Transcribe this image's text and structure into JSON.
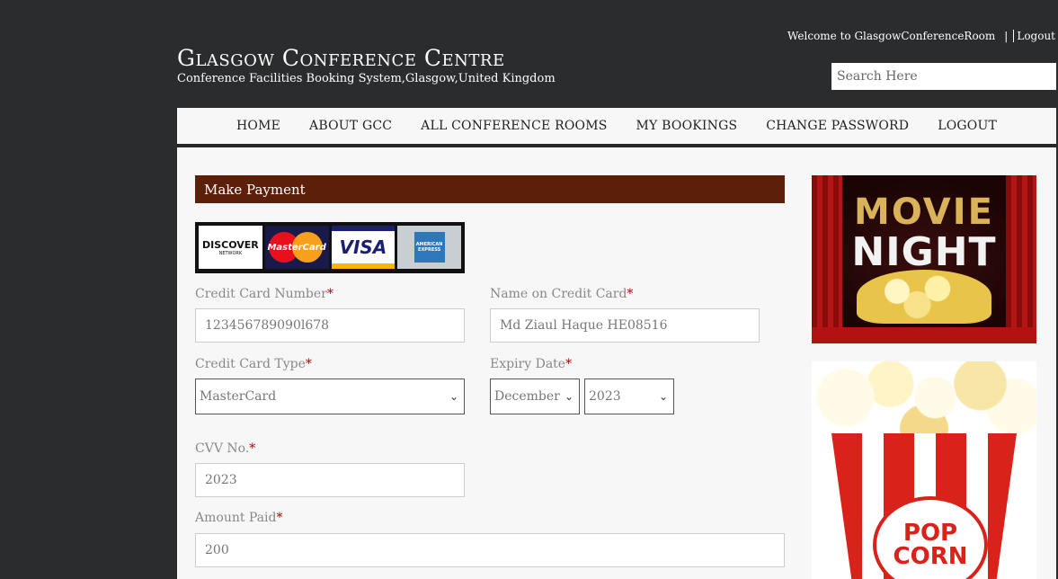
{
  "header": {
    "welcome_text": "Welcome to GlasgowConferenceRoom",
    "separator": "|",
    "logout_label": "Logout",
    "search_placeholder": "Search Here",
    "site_title": "Glasgow Conference Centre",
    "site_subtitle": "Conference Facilities Booking System,Glasgow,United Kingdom"
  },
  "nav": {
    "items": [
      {
        "label": "HOME"
      },
      {
        "label": "ABOUT GCC"
      },
      {
        "label": "ALL CONFERENCE ROOMS"
      },
      {
        "label": "MY BOOKINGS"
      },
      {
        "label": "CHANGE PASSWORD"
      },
      {
        "label": "LOGOUT"
      }
    ]
  },
  "payment": {
    "header": "Make Payment",
    "cards": {
      "discover": "DISCOVER",
      "discover_sub": "NETWORK",
      "mastercard": "MasterCard",
      "visa": "VISA",
      "amex": "AMERICAN EXPRESS"
    },
    "required_mark": "*",
    "card_number_label": "Credit Card Number",
    "card_number_value": "123456789090l678",
    "name_label": "Name on Credit Card",
    "name_value": "Md Ziaul Haque HE08516",
    "card_type_label": "Credit Card Type",
    "card_type_value": "MasterCard",
    "expiry_label": "Expiry Date",
    "expiry_month_value": "December",
    "expiry_year_value": "2023",
    "cvv_label": "CVV No.",
    "cvv_value": "2023",
    "amount_label": "Amount Paid",
    "amount_value": "200"
  },
  "ads": {
    "movie_line1": "MOVIE",
    "movie_line2": "NIGHT",
    "popcorn_line1": "POP",
    "popcorn_line2": "CORN"
  }
}
